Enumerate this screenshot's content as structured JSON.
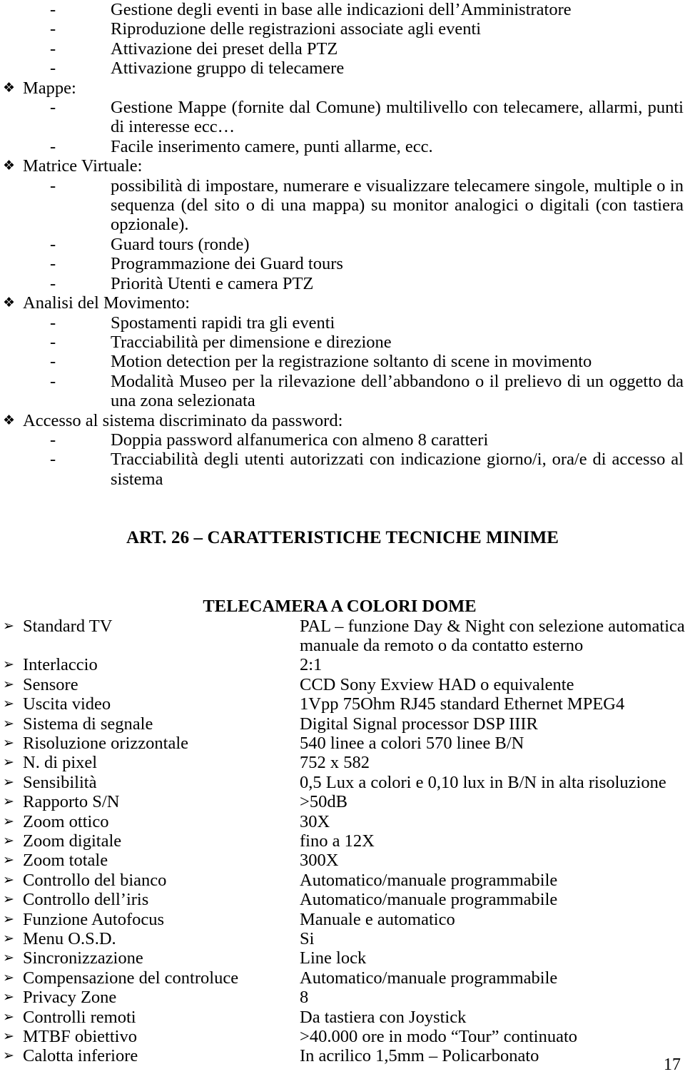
{
  "page": {
    "number": "17",
    "diamond_marker": "❖",
    "dash_marker": "-",
    "arrow_marker": "➢"
  },
  "intro_items": [
    "Gestione degli eventi in base alle indicazioni dell’Amministratore",
    "Riproduzione delle registrazioni associate agli eventi",
    "Attivazione dei preset della PTZ",
    "Attivazione gruppo di telecamere"
  ],
  "sections": [
    {
      "title": "Mappe:",
      "items": [
        {
          "text": "Gestione Mappe (fornite dal Comune) multilivello con telecamere, allarmi, punti di interesse ecc…",
          "justify": true
        },
        {
          "text": "Facile inserimento camere, punti allarme, ecc.",
          "justify": false
        }
      ]
    },
    {
      "title": "Matrice Virtuale:",
      "items": [
        {
          "text": "possibilità di impostare, numerare e visualizzare telecamere singole, multiple o in sequenza (del sito o di una mappa) su monitor analogici o digitali (con tastiera opzionale).",
          "justify": true
        },
        {
          "text": "Guard tours (ronde)",
          "justify": false
        },
        {
          "text": "Programmazione dei Guard tours",
          "justify": false
        },
        {
          "text": "Priorità Utenti e camera PTZ",
          "justify": false
        }
      ]
    },
    {
      "title": "Analisi del Movimento:",
      "items": [
        {
          "text": "Spostamenti rapidi tra gli eventi",
          "justify": false
        },
        {
          "text": "Tracciabilità per dimensione e direzione",
          "justify": false
        },
        {
          "text": "Motion detection per la registrazione soltanto di scene in movimento",
          "justify": false
        },
        {
          "text": "Modalità Museo per la rilevazione dell’abbandono o il prelievo di un oggetto da una zona selezionata",
          "justify": true
        }
      ]
    },
    {
      "title": "Accesso al sistema discriminato da password:",
      "items": [
        {
          "text": "Doppia password alfanumerica con almeno 8 caratteri",
          "justify": false
        },
        {
          "text": "Tracciabilità degli utenti autorizzati con indicazione giorno/i, ora/e di accesso al sistema",
          "justify": true
        }
      ]
    }
  ],
  "article_heading": "ART. 26 – CARATTERISTICHE TECNICHE MINIME",
  "spec_heading": "TELECAMERA A COLORI DOME",
  "spec_rows": [
    {
      "label": "Standard TV",
      "value_lines": [
        "PAL – funzione Day & Night con selezione automatica,",
        "manuale da remoto o da contatto esterno"
      ]
    },
    {
      "label": "Interlaccio",
      "value_lines": [
        "2:1"
      ]
    },
    {
      "label": "Sensore",
      "value_lines": [
        "CCD Sony Exview HAD o equivalente"
      ]
    },
    {
      "label": "Uscita video",
      "value_lines": [
        "1Vpp 75Ohm RJ45 standard Ethernet MPEG4"
      ]
    },
    {
      "label": "Sistema di segnale",
      "value_lines": [
        "Digital Signal processor DSP IIIR"
      ]
    },
    {
      "label": "Risoluzione orizzontale",
      "value_lines": [
        "540 linee a colori 570 linee B/N"
      ]
    },
    {
      "label": "N. di pixel",
      "value_lines": [
        "752 x 582"
      ]
    },
    {
      "label": "Sensibilità",
      "value_lines": [
        "0,5 Lux a colori e 0,10 lux in B/N in alta risoluzione"
      ]
    },
    {
      "label": "Rapporto S/N",
      "value_lines": [
        ">50dB"
      ]
    },
    {
      "label": "Zoom ottico",
      "value_lines": [
        "30X"
      ]
    },
    {
      "label": "Zoom digitale",
      "value_lines": [
        "fino a 12X"
      ]
    },
    {
      "label": "Zoom totale",
      "value_lines": [
        "300X"
      ]
    },
    {
      "label": "Controllo del bianco",
      "value_lines": [
        "Automatico/manuale programmabile"
      ]
    },
    {
      "label": "Controllo dell’iris",
      "value_lines": [
        "Automatico/manuale programmabile"
      ]
    },
    {
      "label": "Funzione Autofocus",
      "value_lines": [
        "Manuale e automatico"
      ]
    },
    {
      "label": "Menu O.S.D.",
      "value_lines": [
        "Si"
      ]
    },
    {
      "label": "Sincronizzazione",
      "value_lines": [
        "Line lock"
      ]
    },
    {
      "label": "Compensazione del controluce",
      "value_lines": [
        "Automatico/manuale programmabile"
      ]
    },
    {
      "label": "Privacy Zone",
      "value_lines": [
        "8"
      ]
    },
    {
      "label": "Controlli remoti",
      "value_lines": [
        "Da tastiera con Joystick"
      ]
    },
    {
      "label": "MTBF obiettivo",
      "value_lines": [
        ">40.000 ore in modo “Tour” continuato"
      ]
    },
    {
      "label": "Calotta inferiore",
      "value_lines": [
        "In acrilico 1,5mm – Policarbonato"
      ]
    }
  ]
}
